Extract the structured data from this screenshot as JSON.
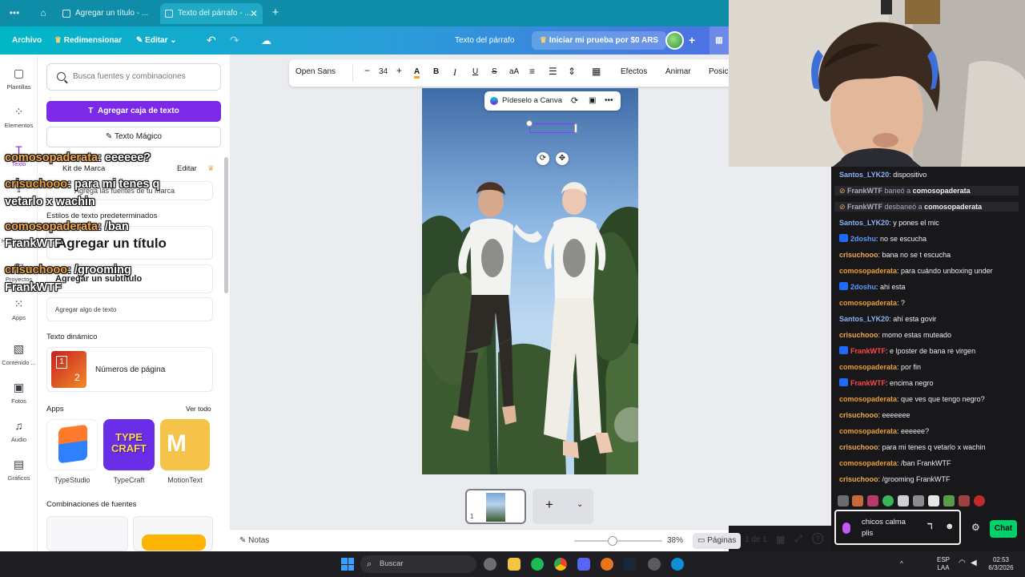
{
  "browser": {
    "tabs": [
      {
        "title": "Agregar un título - ..."
      },
      {
        "title": "Texto del párrafo - ..."
      }
    ],
    "new_tab": "+"
  },
  "topbar": {
    "file": "Archivo",
    "resize": "Redimensionar",
    "edit": "Editar",
    "doc_title": "Texto del párrafo",
    "trial": "Iniciar mi prueba por $0 ARS"
  },
  "rail": [
    {
      "label": "Plantillas",
      "icon": "template-icon"
    },
    {
      "label": "Elementos",
      "icon": "shapes-icon"
    },
    {
      "label": "Texto",
      "icon": "text-icon"
    },
    {
      "label": "Subidos",
      "icon": "upload-icon"
    },
    {
      "label": "Herramient...",
      "icon": "pen-icon"
    },
    {
      "label": "Proyectos",
      "icon": "folder-icon"
    },
    {
      "label": "Apps",
      "icon": "apps-icon"
    },
    {
      "label": "Contenido ...",
      "icon": "magic-icon"
    },
    {
      "label": "Fotos",
      "icon": "photo-icon"
    },
    {
      "label": "Audio",
      "icon": "audio-icon"
    },
    {
      "label": "Gráficos",
      "icon": "chart-icon"
    }
  ],
  "panel": {
    "search_placeholder": "Busca fuentes y combinaciones",
    "add_textbox": "Agregar caja de texto",
    "magic_text": "Texto Mágico",
    "brand_kit": "Kit de Marca",
    "brand_edit": "Editar",
    "brand_fonts": "Agrega las fuentes de tu marca",
    "default_styles": "Estilos de texto predeterminados",
    "add_title": "Agregar un título",
    "add_subtitle": "Agregar un subtítulo",
    "add_body": "Agregar algo de texto",
    "dynamic_text": "Texto dinámico",
    "page_numbers": "Números de página",
    "apps_heading": "Apps",
    "see_all": "Ver todo",
    "apps": [
      {
        "name": "TypeStudio"
      },
      {
        "name": "TypeCraft"
      },
      {
        "name": "MotionText"
      }
    ],
    "font_combos": "Combinaciones de fuentes"
  },
  "overlay_chat": [
    {
      "user": "comosopaderata",
      "text": ": eeeeee?"
    },
    {
      "user": "crisuchooo",
      "text": ": para mi tenes q"
    },
    {
      "user": "",
      "text": "vetarlo x wachin"
    },
    {
      "user": "comosopaderata",
      "text": ": /ban"
    },
    {
      "user": "",
      "text": "FrankWTF"
    },
    {
      "user": "crisuchooo",
      "text": ": /grooming"
    },
    {
      "user": "",
      "text": "FrankWTF"
    }
  ],
  "editor": {
    "font": "Open Sans",
    "font_size": "34",
    "effects": "Efectos",
    "animate": "Animar",
    "position": "Posici",
    "ask_canva": "Pídeselo a Canva",
    "page_num": "1",
    "notes": "Notas",
    "zoom": "38%",
    "zoom_level": 0.38,
    "pages": "Páginas",
    "page_count": "1 de 1"
  },
  "chat": {
    "messages": [
      {
        "user": "Santos_LYK20",
        "color": "#8ab4f8",
        "text": ": dispositivo",
        "badge": false,
        "system": false
      },
      {
        "user": "FrankWTF",
        "color": "#adadb8",
        "text": " baneó a ",
        "target": "comosopaderata",
        "badge": false,
        "system": true
      },
      {
        "user": "FrankWTF",
        "color": "#adadb8",
        "text": " desbaneó a ",
        "target": "comosopaderata",
        "badge": false,
        "system": true
      },
      {
        "user": "Santos_LYK20",
        "color": "#8ab4f8",
        "text": ": y pones el mic",
        "badge": false,
        "system": false
      },
      {
        "user": "2doshu",
        "color": "#5b9bff",
        "text": ": no se escucha",
        "badge": true,
        "system": false
      },
      {
        "user": "crisuchooo",
        "color": "#f0a850",
        "text": ": bana no se t escucha",
        "badge": false,
        "system": false
      },
      {
        "user": "comosopaderata",
        "color": "#e8a03c",
        "text": ": para cuándo unboxing under",
        "badge": false,
        "system": false
      },
      {
        "user": "2doshu",
        "color": "#5b9bff",
        "text": ": ahi esta",
        "badge": true,
        "system": false
      },
      {
        "user": "comosopaderata",
        "color": "#e8a03c",
        "text": ": ?",
        "badge": false,
        "system": false
      },
      {
        "user": "Santos_LYK20",
        "color": "#8ab4f8",
        "text": ": ahí esta govir",
        "badge": false,
        "system": false
      },
      {
        "user": "crisuchooo",
        "color": "#f0a850",
        "text": ": momo estas muteado",
        "badge": false,
        "system": false
      },
      {
        "user": "FrankWTF",
        "color": "#ff4848",
        "text": ": e lposter de bana re virgen",
        "badge": true,
        "system": false
      },
      {
        "user": "comosopaderata",
        "color": "#e8a03c",
        "text": ": por fin",
        "badge": false,
        "system": false
      },
      {
        "user": "FrankWTF",
        "color": "#ff4848",
        "text": ": encima negro",
        "badge": true,
        "system": false
      },
      {
        "user": "comosopaderata",
        "color": "#e8a03c",
        "text": ": que ves que tengo negro?",
        "badge": false,
        "system": false
      },
      {
        "user": "crisuchooo",
        "color": "#f0a850",
        "text": ": eeeeeee",
        "badge": false,
        "system": false
      },
      {
        "user": "comosopaderata",
        "color": "#e8a03c",
        "text": ": eeeeee?",
        "badge": false,
        "system": false
      },
      {
        "user": "crisuchooo",
        "color": "#f0a850",
        "text": ": para mi tenes q vetarlo x wachin",
        "badge": false,
        "system": false
      },
      {
        "user": "comosopaderata",
        "color": "#e8a03c",
        "text": ": /ban FrankWTF",
        "badge": false,
        "system": false
      },
      {
        "user": "crisuchooo",
        "color": "#f0a850",
        "text": ": /grooming FrankWTF",
        "badge": false,
        "system": false
      }
    ],
    "input_line1": "chicos calma",
    "input_line2": "plis",
    "send": "Chat"
  },
  "taskbar": {
    "search": "Buscar",
    "lang1": "ESP",
    "lang2": "LAA",
    "time": "02:53",
    "date": "6/3/2026"
  }
}
